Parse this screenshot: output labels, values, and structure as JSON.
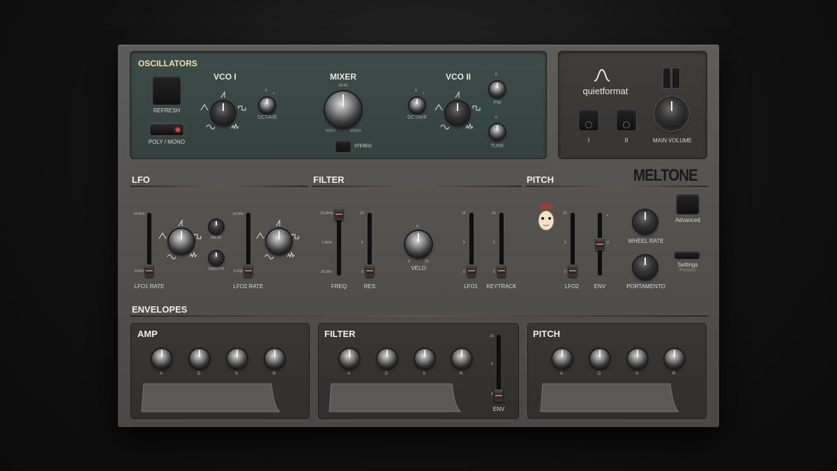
{
  "brand": {
    "product_name": "MELTONE",
    "company": "quietformat"
  },
  "oscillators": {
    "title": "OSCILLATORS",
    "refresh_label": "REFRESH",
    "poly_mono_label": "POLY / MONO",
    "vco1_label": "VCO I",
    "vco2_label": "VCO II",
    "mixer_label": "MIXER",
    "mixer_top": "50:50",
    "mixer_left": "VCO I",
    "mixer_right": "VCO II",
    "octave_label": "OCTAVE",
    "octave_zero": "0",
    "minus": "-",
    "plus": "+",
    "stereo_label": "STEREO",
    "pw_label": "PW",
    "tune_label": "TUNE"
  },
  "master": {
    "btn1_label": "I",
    "btn2_label": "II",
    "main_volume_label": "MAIN VOLUME"
  },
  "lfo": {
    "title": "LFO",
    "top_scale": "14.5Hz",
    "lfo1_bottom": "0.5Hz",
    "lfo2_bottom": "0.2Hz",
    "lfo1_label": "LFO1 RATE",
    "lfo2_label": "LFO2 RATE",
    "delay_label": "DELAY",
    "smooth_label": "SMOOTH"
  },
  "filter": {
    "title": "FILTER",
    "freq_top": "20.0kHz",
    "freq_mid": "1.6kHz",
    "freq_bottom": "20.0Hz",
    "freq_label": "FREQ",
    "res_label": "RES",
    "velo_label": "VELO",
    "velo_top": "5",
    "velo_min": "0",
    "velo_max": "10",
    "lfo1_label": "LFO1",
    "keytrack_label": "KEYTRACK",
    "s10": "10",
    "s5": "5",
    "s0": "0"
  },
  "pitch": {
    "title": "PITCH",
    "lfo2_label": "LFO2",
    "env_label": "ENV",
    "wheel_rate_label": "WHEEL RATE",
    "portamento_label": "PORTAMENTO",
    "advanced_label": "Advanced",
    "settings_label": "Settings",
    "presets_label": "Presets"
  },
  "envelopes": {
    "title": "ENVELOPES",
    "amp_title": "AMP",
    "filter_title": "FILTER",
    "pitch_title": "PITCH",
    "a": "A",
    "d": "D",
    "s": "S",
    "r": "R",
    "env_label": "ENV"
  },
  "colors": {
    "accent_red": "#d36a56",
    "osc_panel": "#3d4c4a",
    "label_yellow": "#f0e3a3"
  }
}
